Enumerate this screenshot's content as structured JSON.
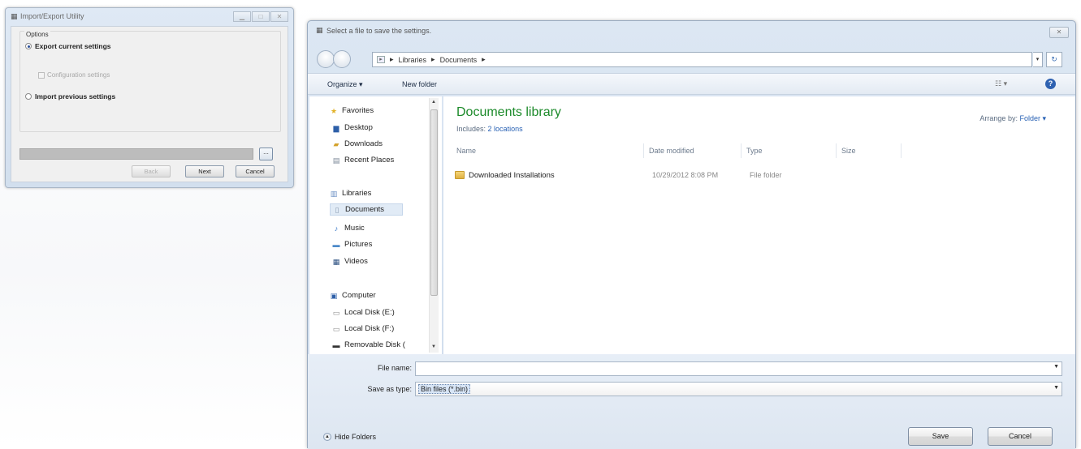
{
  "utility": {
    "title": "Import/Export Utility",
    "options_legend": "Options",
    "export_label": "Export current settings",
    "config_label": "Configuration settings",
    "import_label": "Import previous settings",
    "browse_label": "...",
    "back_label": "Back",
    "next_label": "Next",
    "cancel_label": "Cancel"
  },
  "dialog": {
    "title": "Select a file to save the settings.",
    "close_label": "✕",
    "breadcrumb": [
      "Libraries",
      "Documents"
    ],
    "toolbar": {
      "organize": "Organize ▾",
      "new_folder": "New folder"
    },
    "nav": {
      "favorites": "Favorites",
      "desktop": "Desktop",
      "downloads": "Downloads",
      "recent": "Recent Places",
      "libraries": "Libraries",
      "documents": "Documents",
      "music": "Music",
      "pictures": "Pictures",
      "videos": "Videos",
      "computer": "Computer",
      "disk_e": "Local Disk (E:)",
      "disk_f": "Local Disk (F:)",
      "removable": "Removable Disk ("
    },
    "library": {
      "title": "Documents library",
      "includes_label": "Includes:",
      "includes_value": "2 locations",
      "arrange_label": "Arrange by:",
      "arrange_value": "Folder ▾"
    },
    "columns": [
      "Name",
      "Date modified",
      "Type",
      "Size"
    ],
    "files": [
      {
        "name": "Downloaded Installations",
        "date": "10/29/2012 8:08 PM",
        "type": "File folder"
      }
    ],
    "file_name_label": "File name:",
    "file_name_value": "",
    "save_type_label": "Save as type:",
    "save_type_value": "Bin files (*.bin)",
    "hide_folders": "Hide Folders",
    "save_label": "Save",
    "cancel_label": "Cancel"
  }
}
